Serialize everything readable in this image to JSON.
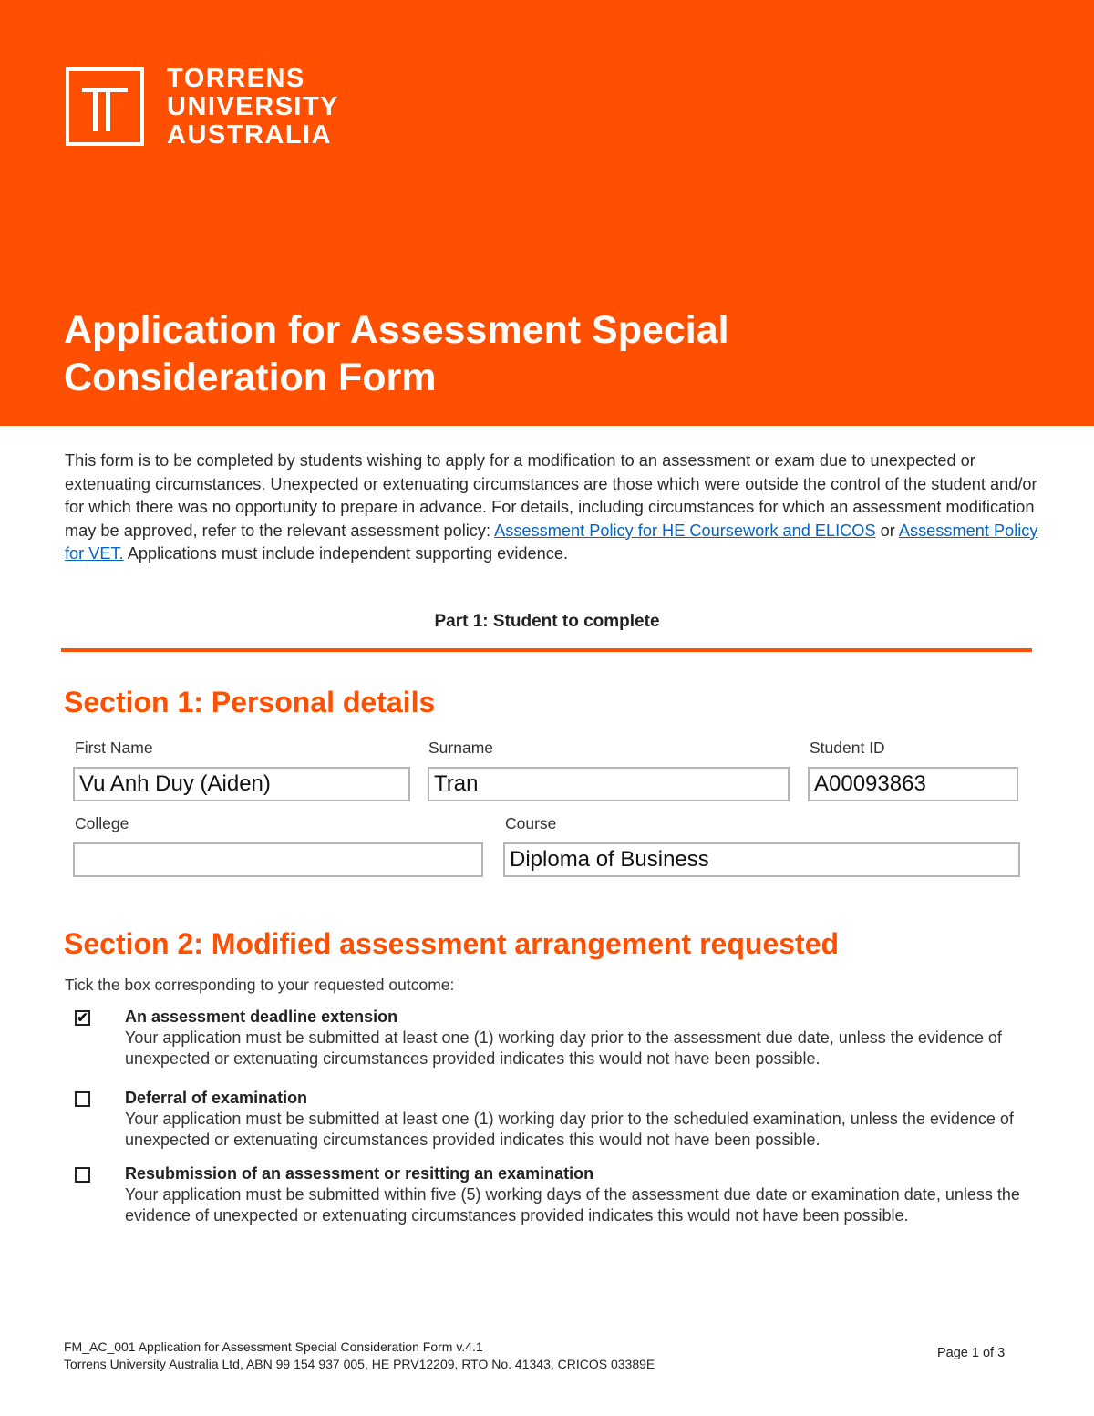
{
  "brand": {
    "logo_lines": [
      "TORRENS",
      "UNIVERSITY",
      "AUSTRALIA"
    ],
    "accent_color": "#fe5000",
    "link_color": "#0563c1"
  },
  "document": {
    "title_line1": "Application for Assessment Special",
    "title_line2": "Consideration Form",
    "intro": {
      "text_before_links": "This form is to be completed by students wishing to apply for a modification to an assessment or exam due to unexpected or extenuating circumstances. Unexpected or extenuating circumstances are those which were outside the control of the student and/or for which there was no opportunity to prepare in advance. For details, including circumstances for which an assessment modification may be approved, refer to the relevant assessment policy: ",
      "link1": "Assessment Policy for HE Coursework and ELICOS",
      "between_links": " or ",
      "link2": "Assessment Policy for VET.",
      "text_after_links": " Applications must include independent supporting evidence."
    },
    "part_heading": "Part 1: Student to complete"
  },
  "section1": {
    "heading": "Section 1: Personal details",
    "fields": {
      "first_name": {
        "label": "First Name",
        "value": "Vu Anh Duy (Aiden)"
      },
      "surname": {
        "label": "Surname",
        "value": "Tran"
      },
      "student_id": {
        "label": "Student ID",
        "value": "A00093863"
      },
      "college": {
        "label": "College",
        "value": ""
      },
      "course": {
        "label": "Course",
        "value": "Diploma of Business"
      }
    }
  },
  "section2": {
    "heading": "Section 2: Modified assessment arrangement requested",
    "instruction": "Tick the box corresponding to your requested outcome:",
    "options": [
      {
        "title": "An assessment deadline extension",
        "description": "Your application must be submitted at least one (1) working day prior to the assessment due date, unless the evidence of unexpected or extenuating circumstances provided indicates this would not have been possible.",
        "checked": true,
        "mark": "✔"
      },
      {
        "title": "Deferral of examination",
        "description": "Your application must be submitted at least one (1) working day prior to the scheduled examination, unless the evidence of unexpected or extenuating circumstances provided indicates this would not have been possible.",
        "checked": false,
        "mark": ""
      },
      {
        "title": "Resubmission of an assessment or resitting an examination",
        "description": "Your application must be submitted within five (5) working days of the assessment due date or examination date, unless the evidence of unexpected or extenuating circumstances provided indicates this would not have been possible.",
        "checked": false,
        "mark": ""
      }
    ]
  },
  "footer": {
    "line1": "FM_AC_001 Application for Assessment Special Consideration Form v.4.1",
    "line2": "Torrens University Australia Ltd, ABN 99 154 937 005, HE PRV12209, RTO No. 41343, CRICOS 03389E",
    "page": "Page 1 of 3"
  }
}
